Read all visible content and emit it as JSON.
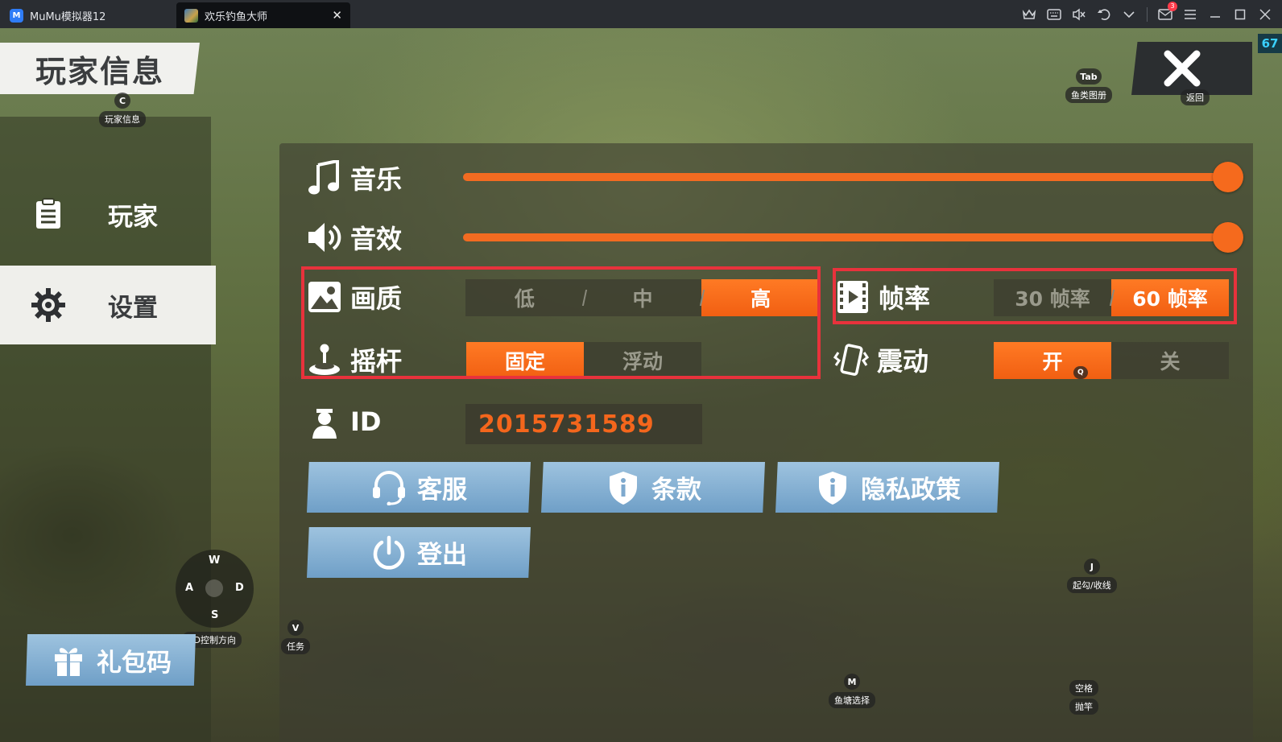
{
  "titlebar": {
    "tabs": [
      {
        "label": "MuMu模拟器12",
        "active": false
      },
      {
        "label": "欢乐钓鱼大师",
        "active": true
      }
    ],
    "app_logo_text": "M",
    "tab_close_glyph": "✕",
    "mail_badge": "3",
    "icons": [
      "crown-icon",
      "keyboard-icon",
      "mute-icon",
      "undo-icon",
      "chevron-down-icon",
      "mail-icon",
      "menu-icon",
      "minimize-icon",
      "maximize-icon",
      "close-window-icon"
    ]
  },
  "game": {
    "fps": "67",
    "header": {
      "title": "玩家信息"
    },
    "hints": {
      "player_info": {
        "key": "C",
        "label": "玩家信息"
      },
      "fish_album": {
        "key": "Tab",
        "label": "鱼类图册"
      },
      "back": {
        "label": "返回"
      },
      "hook": {
        "key": "J",
        "label": "起勾/收线"
      },
      "task": {
        "key": "V",
        "label": "任务"
      },
      "pond": {
        "key": "M",
        "label": "鱼塘选择"
      },
      "cast": {
        "key": "空格",
        "label": "抛竿"
      },
      "dpad": {
        "up": "W",
        "left": "A",
        "right": "D",
        "down": "S",
        "label": "AD控制方向"
      },
      "vibrate_key": "Q"
    },
    "sidebar": {
      "items": [
        {
          "label": "玩家",
          "icon": "clipboard-icon",
          "active": false
        },
        {
          "label": "设置",
          "icon": "gear-icon",
          "active": true
        }
      ]
    },
    "gift_code_button": "礼包码",
    "settings": {
      "music": {
        "label": "音乐",
        "level": 1.0
      },
      "sfx": {
        "label": "音效",
        "level": 1.0
      },
      "quality": {
        "label": "画质",
        "options": [
          "低",
          "中",
          "高"
        ],
        "selected": 2
      },
      "framerate": {
        "label": "帧率",
        "options": [
          "30 帧率",
          "60 帧率"
        ],
        "selected": 1
      },
      "joystick": {
        "label": "摇杆",
        "options": [
          "固定",
          "浮动"
        ],
        "selected": 0
      },
      "vibration": {
        "label": "震动",
        "options": [
          "开",
          "关"
        ],
        "selected": 0
      },
      "id": {
        "label": "ID",
        "value": "2015731589"
      },
      "buttons": {
        "support": "客服",
        "terms": "条款",
        "privacy": "隐私政策",
        "logout": "登出"
      }
    },
    "colors": {
      "accent": "#f26b21",
      "highlight_box": "#e8323c",
      "button_blue": "#7fb0d6"
    }
  }
}
